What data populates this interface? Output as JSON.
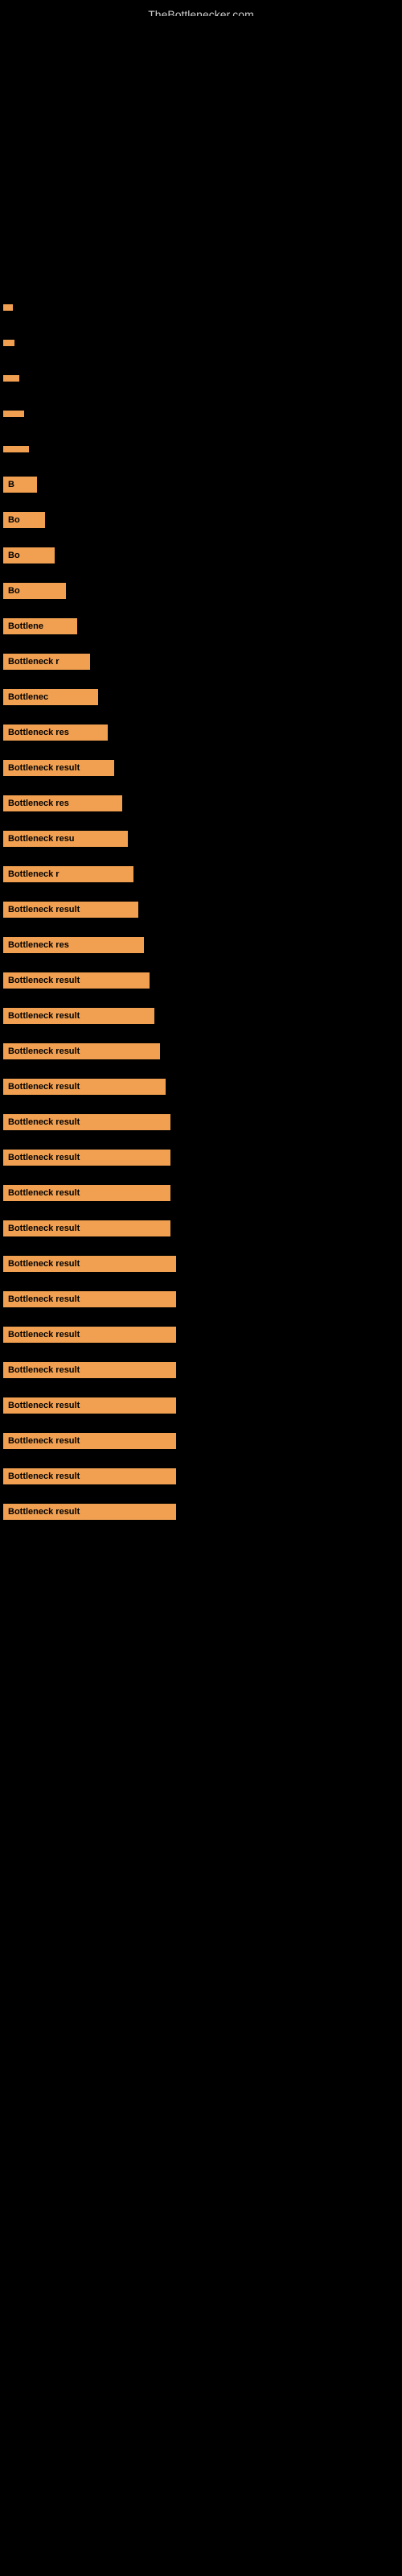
{
  "site": {
    "title": "TheBottlenecker.com"
  },
  "bars": [
    {
      "id": 1,
      "label": "",
      "widthClass": "bar-w-1"
    },
    {
      "id": 2,
      "label": "",
      "widthClass": "bar-w-2"
    },
    {
      "id": 3,
      "label": "",
      "widthClass": "bar-w-3"
    },
    {
      "id": 4,
      "label": "",
      "widthClass": "bar-w-4"
    },
    {
      "id": 5,
      "label": "",
      "widthClass": "bar-w-5"
    },
    {
      "id": 6,
      "label": "B",
      "widthClass": "bar-w-6"
    },
    {
      "id": 7,
      "label": "Bo",
      "widthClass": "bar-w-7"
    },
    {
      "id": 8,
      "label": "Bo",
      "widthClass": "bar-w-8"
    },
    {
      "id": 9,
      "label": "Bo",
      "widthClass": "bar-w-9"
    },
    {
      "id": 10,
      "label": "Bottlene",
      "widthClass": "bar-w-10"
    },
    {
      "id": 11,
      "label": "Bottleneck r",
      "widthClass": "bar-w-11"
    },
    {
      "id": 12,
      "label": "Bottlenec",
      "widthClass": "bar-w-12"
    },
    {
      "id": 13,
      "label": "Bottleneck res",
      "widthClass": "bar-w-13"
    },
    {
      "id": 14,
      "label": "Bottleneck result",
      "widthClass": "bar-w-14"
    },
    {
      "id": 15,
      "label": "Bottleneck res",
      "widthClass": "bar-w-15"
    },
    {
      "id": 16,
      "label": "Bottleneck resu",
      "widthClass": "bar-w-16"
    },
    {
      "id": 17,
      "label": "Bottleneck r",
      "widthClass": "bar-w-17"
    },
    {
      "id": 18,
      "label": "Bottleneck result",
      "widthClass": "bar-w-18"
    },
    {
      "id": 19,
      "label": "Bottleneck res",
      "widthClass": "bar-w-19"
    },
    {
      "id": 20,
      "label": "Bottleneck result",
      "widthClass": "bar-w-20"
    },
    {
      "id": 21,
      "label": "Bottleneck result",
      "widthClass": "bar-w-21"
    },
    {
      "id": 22,
      "label": "Bottleneck result",
      "widthClass": "bar-w-22"
    },
    {
      "id": 23,
      "label": "Bottleneck result",
      "widthClass": "bar-w-23"
    },
    {
      "id": 24,
      "label": "Bottleneck result",
      "widthClass": "bar-w-24"
    },
    {
      "id": 25,
      "label": "Bottleneck result",
      "widthClass": "bar-w-24"
    },
    {
      "id": 26,
      "label": "Bottleneck result",
      "widthClass": "bar-w-24"
    },
    {
      "id": 27,
      "label": "Bottleneck result",
      "widthClass": "bar-w-24"
    },
    {
      "id": 28,
      "label": "Bottleneck result",
      "widthClass": "bar-w-25"
    },
    {
      "id": 29,
      "label": "Bottleneck result",
      "widthClass": "bar-w-25"
    },
    {
      "id": 30,
      "label": "Bottleneck result",
      "widthClass": "bar-w-25"
    },
    {
      "id": 31,
      "label": "Bottleneck result",
      "widthClass": "bar-w-25"
    },
    {
      "id": 32,
      "label": "Bottleneck result",
      "widthClass": "bar-w-25"
    },
    {
      "id": 33,
      "label": "Bottleneck result",
      "widthClass": "bar-w-25"
    },
    {
      "id": 34,
      "label": "Bottleneck result",
      "widthClass": "bar-w-25"
    },
    {
      "id": 35,
      "label": "Bottleneck result",
      "widthClass": "bar-w-25"
    }
  ]
}
